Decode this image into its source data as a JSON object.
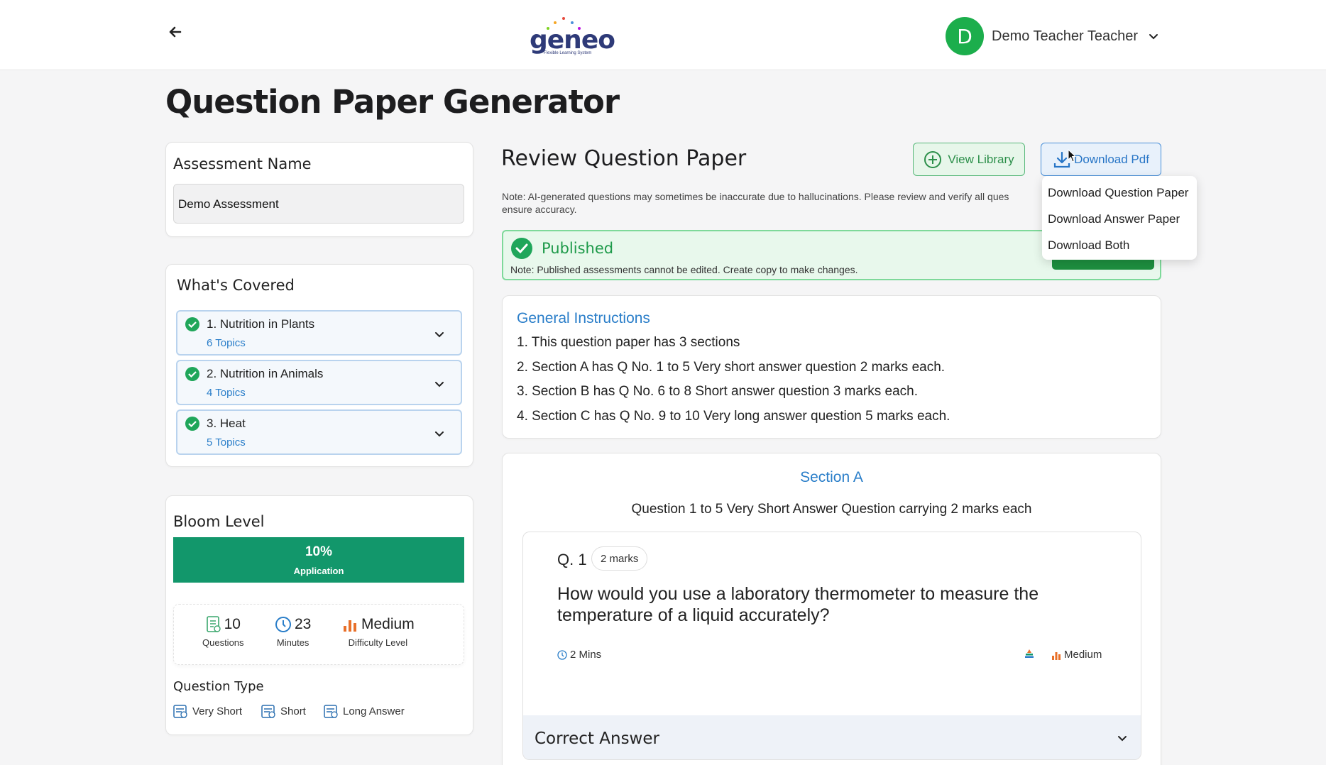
{
  "header": {
    "logo_text": "geneo",
    "logo_tagline": "Flexible Learning System",
    "user_initial": "D",
    "user_name": "Demo Teacher Teacher"
  },
  "page_title": "Question Paper Generator",
  "assessment": {
    "title": "Assessment Name",
    "value": "Demo Assessment"
  },
  "covered": {
    "title": "What's Covered",
    "chapters": [
      {
        "name": "1. Nutrition in Plants",
        "topics": "6 Topics"
      },
      {
        "name": "2. Nutrition in Animals",
        "topics": "4 Topics"
      },
      {
        "name": "3. Heat",
        "topics": "5 Topics"
      }
    ]
  },
  "bloom": {
    "title": "Bloom Level",
    "percent": "10%",
    "level": "Application",
    "stats": {
      "questions_value": "10",
      "questions_label": "Questions",
      "minutes_value": "23",
      "minutes_label": "Minutes",
      "difficulty_value": "Medium",
      "difficulty_label": "Difficulty Level"
    },
    "question_type_title": "Question Type",
    "question_types": [
      "Very Short",
      "Short",
      "Long Answer"
    ]
  },
  "review": {
    "title": "Review Question Paper",
    "view_library": "View Library",
    "download_pdf": "Download Pdf",
    "note_line1": "Note: AI-generated questions may sometimes be inaccurate due to hallucinations. Please review and verify all ques",
    "note_line2": "ensure accuracy.",
    "published_title": "Published",
    "published_note": "Note: Published assessments cannot be edited. Create copy to make changes."
  },
  "download_menu": [
    "Download Question Paper",
    "Download Answer Paper",
    "Download Both"
  ],
  "instructions": {
    "title": "General Instructions",
    "lines": [
      "1. This question paper has 3 sections",
      "2. Section A has Q No. 1 to 5 Very short answer question 2 marks each.",
      "3. Section B has Q No. 6 to 8 Short answer question 3 marks each.",
      "4. Section C has Q No. 9 to 10 Very long answer question 5 marks each."
    ]
  },
  "section": {
    "title": "Section A",
    "subtitle": "Question 1 to 5 Very Short Answer Question carrying 2 marks each",
    "question": {
      "number": "Q. 1",
      "marks": "2 marks",
      "text": "How would you use a laboratory thermometer to measure the temperature of a liquid accurately?",
      "time": "2 Mins",
      "difficulty": "Medium",
      "answer_label": "Correct Answer"
    }
  },
  "colors": {
    "brand_green": "#12976b",
    "link_blue": "#2a7ec9",
    "avatar_green": "#1cae4c"
  }
}
